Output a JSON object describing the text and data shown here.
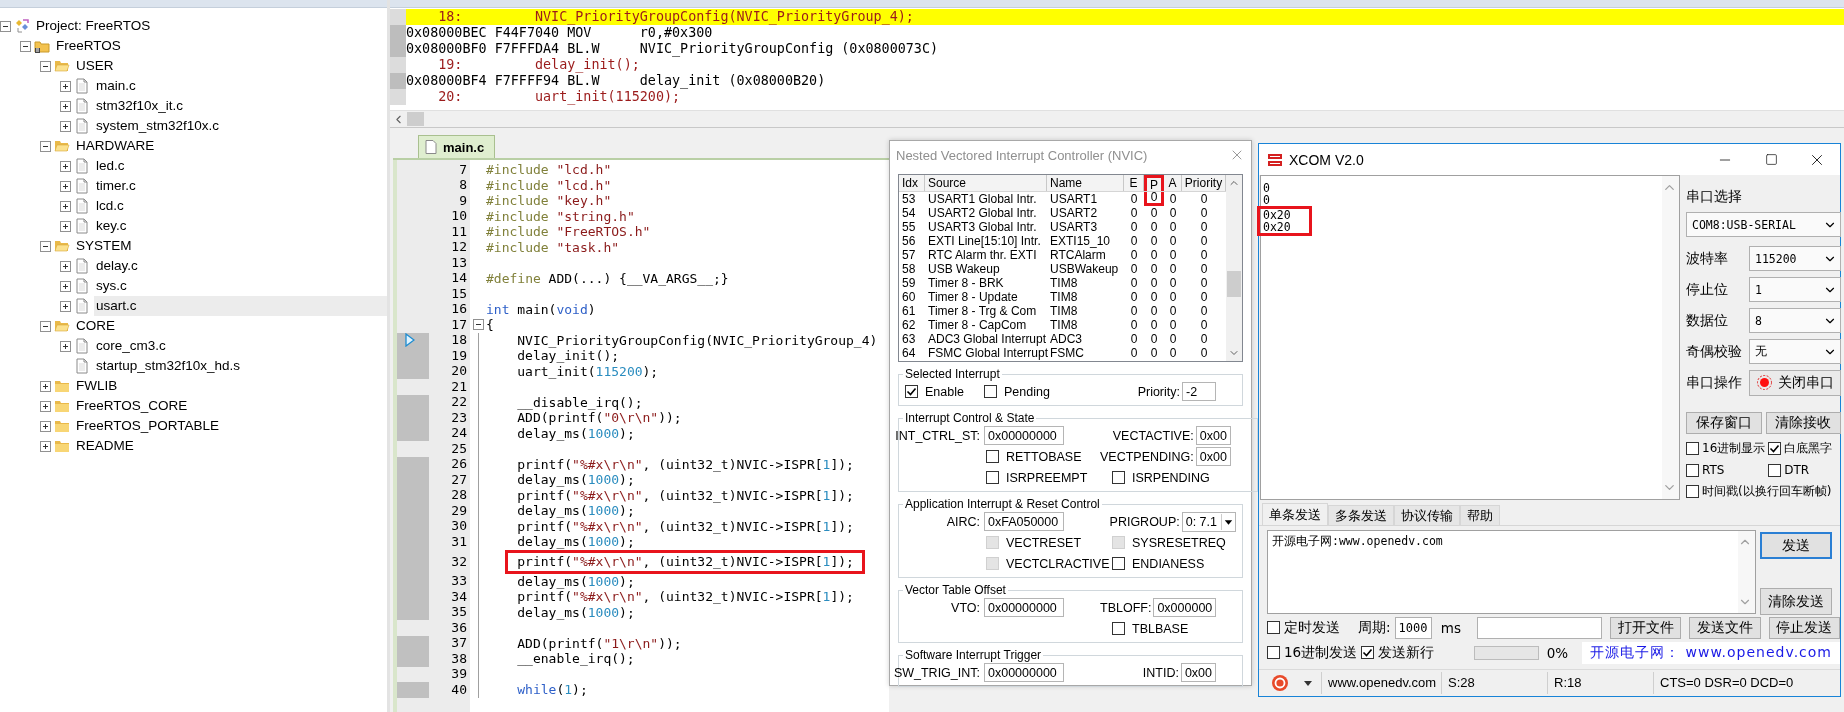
{
  "project": {
    "tree": [
      {
        "label": "Project: FreeRTOS",
        "kind": "project",
        "expanded": true,
        "selected": false,
        "children": [
          {
            "label": "FreeRTOS",
            "kind": "target",
            "expanded": true,
            "selected": false,
            "children": [
              {
                "label": "USER",
                "kind": "folder",
                "expanded": true,
                "selected": false,
                "children": [
                  {
                    "label": "main.c",
                    "kind": "file",
                    "expanded": false,
                    "selected": false
                  },
                  {
                    "label": "stm32f10x_it.c",
                    "kind": "file",
                    "expanded": false,
                    "selected": false
                  },
                  {
                    "label": "system_stm32f10x.c",
                    "kind": "file",
                    "expanded": false,
                    "selected": false
                  }
                ]
              },
              {
                "label": "HARDWARE",
                "kind": "folder",
                "expanded": true,
                "selected": false,
                "children": [
                  {
                    "label": "led.c",
                    "kind": "file",
                    "expanded": false,
                    "selected": false
                  },
                  {
                    "label": "timer.c",
                    "kind": "file",
                    "expanded": false,
                    "selected": false
                  },
                  {
                    "label": "lcd.c",
                    "kind": "file",
                    "expanded": false,
                    "selected": false
                  },
                  {
                    "label": "key.c",
                    "kind": "file",
                    "expanded": false,
                    "selected": false
                  }
                ]
              },
              {
                "label": "SYSTEM",
                "kind": "folder",
                "expanded": true,
                "selected": false,
                "children": [
                  {
                    "label": "delay.c",
                    "kind": "file",
                    "expanded": false,
                    "selected": false
                  },
                  {
                    "label": "sys.c",
                    "kind": "file",
                    "expanded": false,
                    "selected": false
                  },
                  {
                    "label": "usart.c",
                    "kind": "file",
                    "expanded": false,
                    "selected": true
                  }
                ]
              },
              {
                "label": "CORE",
                "kind": "folder",
                "expanded": true,
                "selected": false,
                "children": [
                  {
                    "label": "core_cm3.c",
                    "kind": "file",
                    "expanded": false,
                    "selected": false
                  },
                  {
                    "label": "startup_stm32f10x_hd.s",
                    "kind": "file",
                    "selected": false
                  }
                ]
              },
              {
                "label": "FWLIB",
                "kind": "folder",
                "expanded": false,
                "selected": false
              },
              {
                "label": "FreeRTOS_CORE",
                "kind": "folder",
                "expanded": false,
                "selected": false
              },
              {
                "label": "FreeRTOS_PORTABLE",
                "kind": "folder",
                "expanded": false,
                "selected": false
              },
              {
                "label": "README",
                "kind": "folder",
                "expanded": false,
                "selected": false
              }
            ]
          }
        ]
      }
    ]
  },
  "disassembly": {
    "lines": [
      {
        "kind": "source",
        "number": "18:",
        "text": "NVIC_PriorityGroupConfig(NVIC_PriorityGroup_4);",
        "current": true
      },
      {
        "kind": "asm",
        "address": "0x08000BEC",
        "opcode": "F44F7040",
        "mnemonic": "MOV",
        "operands": "r0,#0x300",
        "current": false
      },
      {
        "kind": "asm",
        "address": "0x08000BF0",
        "opcode": "F7FFFDA4",
        "mnemonic": "BL.W",
        "operands": "NVIC_PriorityGroupConfig (0x0800073C)",
        "current": false
      },
      {
        "kind": "source",
        "number": "19:",
        "text": "delay_init();",
        "current": false
      },
      {
        "kind": "asm",
        "address": "0x08000BF4",
        "opcode": "F7FFFF94",
        "mnemonic": "BL.W",
        "operands": "delay_init (0x08000B20)",
        "current": false
      },
      {
        "kind": "source",
        "number": "20:",
        "text": "uart_init(115200);",
        "current": false
      }
    ]
  },
  "editor": {
    "tabs": [
      {
        "label": "main.c",
        "selected": true
      }
    ],
    "lines": [
      {
        "number": "7",
        "indent": false,
        "executable": false,
        "current": false,
        "fold": false,
        "marked": false,
        "tokens": [
          {
            "kind": "pp",
            "text": "#include"
          },
          {
            "kind": "str",
            "text": " \"lcd.h\""
          }
        ]
      },
      {
        "number": "8",
        "indent": false,
        "executable": false,
        "current": false,
        "fold": false,
        "marked": false,
        "tokens": [
          {
            "kind": "pp",
            "text": "#include"
          },
          {
            "kind": "str",
            "text": " \"lcd.h\""
          }
        ]
      },
      {
        "number": "9",
        "indent": false,
        "executable": false,
        "current": false,
        "fold": false,
        "marked": false,
        "tokens": [
          {
            "kind": "pp",
            "text": "#include"
          },
          {
            "kind": "str",
            "text": " \"key.h\""
          }
        ]
      },
      {
        "number": "10",
        "indent": false,
        "executable": false,
        "current": false,
        "fold": false,
        "marked": false,
        "tokens": [
          {
            "kind": "pp",
            "text": "#include"
          },
          {
            "kind": "str",
            "text": " \"string.h\""
          }
        ]
      },
      {
        "number": "11",
        "indent": false,
        "executable": false,
        "current": false,
        "fold": false,
        "marked": false,
        "tokens": [
          {
            "kind": "pp",
            "text": "#include"
          },
          {
            "kind": "str",
            "text": " \"FreeRTOS.h\""
          }
        ]
      },
      {
        "number": "12",
        "indent": false,
        "executable": false,
        "current": false,
        "fold": false,
        "marked": false,
        "tokens": [
          {
            "kind": "pp",
            "text": "#include"
          },
          {
            "kind": "str",
            "text": " \"task.h\""
          }
        ]
      },
      {
        "number": "13",
        "executable": false,
        "current": false,
        "fold": false,
        "marked": false
      },
      {
        "number": "14",
        "indent": false,
        "executable": false,
        "current": false,
        "fold": false,
        "marked": false,
        "tokens": [
          {
            "kind": "pp",
            "text": "#define"
          },
          {
            "kind": "plain",
            "text": " ADD(...) {__VA_ARGS__;}"
          }
        ]
      },
      {
        "number": "15",
        "executable": false,
        "current": false,
        "fold": false,
        "marked": false
      },
      {
        "number": "16",
        "indent": false,
        "executable": false,
        "current": false,
        "fold": false,
        "marked": false,
        "tokens": [
          {
            "kind": "kw",
            "text": "int"
          },
          {
            "kind": "plain",
            "text": " main("
          },
          {
            "kind": "kw",
            "text": "void"
          },
          {
            "kind": "plain",
            "text": ")"
          }
        ]
      },
      {
        "number": "17",
        "indent": false,
        "executable": false,
        "current": false,
        "fold": true,
        "marked": false,
        "tokens": [
          {
            "kind": "plain",
            "text": "{"
          }
        ]
      },
      {
        "number": "18",
        "indent": true,
        "executable": true,
        "current": true,
        "fold": false,
        "marked": false,
        "tokens": [
          {
            "kind": "plain",
            "text": "NVIC_PriorityGroupConfig(NVIC_PriorityGroup_4)"
          }
        ]
      },
      {
        "number": "19",
        "indent": true,
        "executable": true,
        "current": false,
        "fold": false,
        "marked": false,
        "tokens": [
          {
            "kind": "plain",
            "text": "delay_init();"
          }
        ]
      },
      {
        "number": "20",
        "indent": true,
        "executable": true,
        "current": false,
        "fold": false,
        "marked": false,
        "tokens": [
          {
            "kind": "plain",
            "text": "uart_init("
          },
          {
            "kind": "num",
            "text": "115200"
          },
          {
            "kind": "plain",
            "text": ");"
          }
        ]
      },
      {
        "number": "21",
        "executable": false,
        "current": false,
        "fold": false,
        "marked": false
      },
      {
        "number": "22",
        "indent": true,
        "executable": true,
        "current": false,
        "fold": false,
        "marked": false,
        "tokens": [
          {
            "kind": "plain",
            "text": "__disable_irq();"
          }
        ]
      },
      {
        "number": "23",
        "indent": true,
        "executable": true,
        "current": false,
        "fold": false,
        "marked": false,
        "tokens": [
          {
            "kind": "plain",
            "text": "ADD(printf("
          },
          {
            "kind": "str",
            "text": "\"0\\r\\n\""
          },
          {
            "kind": "plain",
            "text": "));"
          }
        ]
      },
      {
        "number": "24",
        "indent": true,
        "executable": true,
        "current": false,
        "fold": false,
        "marked": false,
        "tokens": [
          {
            "kind": "plain",
            "text": "delay_ms("
          },
          {
            "kind": "num",
            "text": "1000"
          },
          {
            "kind": "plain",
            "text": ");"
          }
        ]
      },
      {
        "number": "25",
        "executable": false,
        "current": false,
        "fold": false,
        "marked": false
      },
      {
        "number": "26",
        "indent": true,
        "executable": true,
        "current": false,
        "fold": false,
        "marked": false,
        "tokens": [
          {
            "kind": "plain",
            "text": "printf("
          },
          {
            "kind": "str",
            "text": "\"%#x\\r\\n\""
          },
          {
            "kind": "plain",
            "text": ", (uint32_t)NVIC->ISPR["
          },
          {
            "kind": "num",
            "text": "1"
          },
          {
            "kind": "plain",
            "text": "]);"
          }
        ]
      },
      {
        "number": "27",
        "indent": true,
        "executable": true,
        "current": false,
        "fold": false,
        "marked": false,
        "tokens": [
          {
            "kind": "plain",
            "text": "delay_ms("
          },
          {
            "kind": "num",
            "text": "1000"
          },
          {
            "kind": "plain",
            "text": ");"
          }
        ]
      },
      {
        "number": "28",
        "indent": true,
        "executable": true,
        "current": false,
        "fold": false,
        "marked": false,
        "tokens": [
          {
            "kind": "plain",
            "text": "printf("
          },
          {
            "kind": "str",
            "text": "\"%#x\\r\\n\""
          },
          {
            "kind": "plain",
            "text": ", (uint32_t)NVIC->ISPR["
          },
          {
            "kind": "num",
            "text": "1"
          },
          {
            "kind": "plain",
            "text": "]);"
          }
        ]
      },
      {
        "number": "29",
        "indent": true,
        "executable": true,
        "current": false,
        "fold": false,
        "marked": false,
        "tokens": [
          {
            "kind": "plain",
            "text": "delay_ms("
          },
          {
            "kind": "num",
            "text": "1000"
          },
          {
            "kind": "plain",
            "text": ");"
          }
        ]
      },
      {
        "number": "30",
        "indent": true,
        "executable": true,
        "current": false,
        "fold": false,
        "marked": false,
        "tokens": [
          {
            "kind": "plain",
            "text": "printf("
          },
          {
            "kind": "str",
            "text": "\"%#x\\r\\n\""
          },
          {
            "kind": "plain",
            "text": ", (uint32_t)NVIC->ISPR["
          },
          {
            "kind": "num",
            "text": "1"
          },
          {
            "kind": "plain",
            "text": "]);"
          }
        ]
      },
      {
        "number": "31",
        "indent": true,
        "executable": true,
        "current": false,
        "fold": false,
        "marked": false,
        "tokens": [
          {
            "kind": "plain",
            "text": "delay_ms("
          },
          {
            "kind": "num",
            "text": "1000"
          },
          {
            "kind": "plain",
            "text": ");"
          }
        ]
      },
      {
        "number": "32",
        "indent": true,
        "executable": true,
        "current": false,
        "fold": false,
        "marked": true,
        "tokens": [
          {
            "kind": "plain",
            "text": "printf("
          },
          {
            "kind": "str",
            "text": "\"%#x\\r\\n\""
          },
          {
            "kind": "plain",
            "text": ", (uint32_t)NVIC->ISPR["
          },
          {
            "kind": "num",
            "text": "1"
          },
          {
            "kind": "plain",
            "text": "]);"
          }
        ]
      },
      {
        "number": "33",
        "indent": true,
        "executable": true,
        "current": false,
        "fold": false,
        "marked": false,
        "tokens": [
          {
            "kind": "plain",
            "text": "delay_ms("
          },
          {
            "kind": "num",
            "text": "1000"
          },
          {
            "kind": "plain",
            "text": ");"
          }
        ]
      },
      {
        "number": "34",
        "indent": true,
        "executable": true,
        "current": false,
        "fold": false,
        "marked": false,
        "tokens": [
          {
            "kind": "plain",
            "text": "printf("
          },
          {
            "kind": "str",
            "text": "\"%#x\\r\\n\""
          },
          {
            "kind": "plain",
            "text": ", (uint32_t)NVIC->ISPR["
          },
          {
            "kind": "num",
            "text": "1"
          },
          {
            "kind": "plain",
            "text": "]);"
          }
        ]
      },
      {
        "number": "35",
        "indent": true,
        "executable": true,
        "current": false,
        "fold": false,
        "marked": false,
        "tokens": [
          {
            "kind": "plain",
            "text": "delay_ms("
          },
          {
            "kind": "num",
            "text": "1000"
          },
          {
            "kind": "plain",
            "text": ");"
          }
        ]
      },
      {
        "number": "36",
        "executable": false,
        "current": false,
        "fold": false,
        "marked": false
      },
      {
        "number": "37",
        "indent": true,
        "executable": true,
        "current": false,
        "fold": false,
        "marked": false,
        "tokens": [
          {
            "kind": "plain",
            "text": "ADD(printf("
          },
          {
            "kind": "str",
            "text": "\"1\\r\\n\""
          },
          {
            "kind": "plain",
            "text": "));"
          }
        ]
      },
      {
        "number": "38",
        "indent": true,
        "executable": true,
        "current": false,
        "fold": false,
        "marked": false,
        "tokens": [
          {
            "kind": "plain",
            "text": "__enable_irq();"
          }
        ]
      },
      {
        "number": "39",
        "executable": false,
        "current": false,
        "fold": false,
        "marked": false
      },
      {
        "number": "40",
        "indent": true,
        "executable": true,
        "current": false,
        "fold": false,
        "marked": false,
        "tokens": [
          {
            "kind": "kw",
            "text": "while"
          },
          {
            "kind": "plain",
            "text": "("
          },
          {
            "kind": "num",
            "text": "1"
          },
          {
            "kind": "plain",
            "text": ");"
          }
        ]
      }
    ]
  },
  "nvic": {
    "title": "Nested Vectored Interrupt Controller (NVIC)",
    "columns": [
      {
        "label": "Idx",
        "marked": false
      },
      {
        "label": "Source",
        "marked": false
      },
      {
        "label": "Name",
        "marked": false
      },
      {
        "label": "E",
        "marked": false
      },
      {
        "label": "P",
        "marked": true
      },
      {
        "label": "A",
        "marked": false
      },
      {
        "label": "Priority",
        "marked": false
      }
    ],
    "rows": [
      {
        "cells": [
          "53",
          "USART1 Global Intr.",
          "USART1",
          "0",
          "0",
          "0",
          "0"
        ]
      },
      {
        "cells": [
          "54",
          "USART2 Global Intr.",
          "USART2",
          "0",
          "0",
          "0",
          "0"
        ]
      },
      {
        "cells": [
          "55",
          "USART3 Global Intr.",
          "USART3",
          "0",
          "0",
          "0",
          "0"
        ]
      },
      {
        "cells": [
          "56",
          "EXTI Line[15:10] Intr.",
          "EXTI15_10",
          "0",
          "0",
          "0",
          "0"
        ]
      },
      {
        "cells": [
          "57",
          "RTC Alarm thr. EXTI",
          "RTCAlarm",
          "0",
          "0",
          "0",
          "0"
        ]
      },
      {
        "cells": [
          "58",
          "USB Wakeup",
          "USBWakeup",
          "0",
          "0",
          "0",
          "0"
        ]
      },
      {
        "cells": [
          "59",
          "Timer 8 - BRK",
          "TIM8",
          "0",
          "0",
          "0",
          "0"
        ]
      },
      {
        "cells": [
          "60",
          "Timer 8 - Update",
          "TIM8",
          "0",
          "0",
          "0",
          "0"
        ]
      },
      {
        "cells": [
          "61",
          "Timer 8 - Trg & Com",
          "TIM8",
          "0",
          "0",
          "0",
          "0"
        ]
      },
      {
        "cells": [
          "62",
          "Timer 8 - CapCom",
          "TIM8",
          "0",
          "0",
          "0",
          "0"
        ]
      },
      {
        "cells": [
          "63",
          "ADC3 Global Interrupt",
          "ADC3",
          "0",
          "0",
          "0",
          "0"
        ]
      },
      {
        "cells": [
          "64",
          "FSMC Global Interrupt",
          "FSMC",
          "0",
          "0",
          "0",
          "0"
        ]
      }
    ],
    "groups": [
      {
        "title": "Selected Interrupt",
        "rows": [
          {
            "left": [
              {
                "kind": "checkbox",
                "label": "Enable",
                "checked": true,
                "disabled": false
              },
              {
                "kind": "checkbox",
                "label": "Pending",
                "checked": false,
                "disabled": false
              }
            ],
            "right": [
              {
                "kind": "field",
                "label": "Priority:",
                "value": "-2"
              }
            ]
          }
        ]
      },
      {
        "title": "Interrupt Control & State",
        "rows": [
          {
            "left": [
              {
                "kind": "field",
                "label": "INT_CTRL_ST:",
                "value": "0x00000000"
              }
            ],
            "right": [
              {
                "kind": "field",
                "label": "VECTACTIVE:",
                "value": "0x00"
              }
            ]
          },
          {
            "left": [
              {
                "kind": "checkbox",
                "label": "RETTOBASE",
                "checked": false,
                "disabled": false
              }
            ],
            "right": [
              {
                "kind": "field",
                "label": "VECTPENDING:",
                "value": "0x00"
              }
            ]
          },
          {
            "left": [
              {
                "kind": "checkbox",
                "label": "ISRPREEMPT",
                "checked": false,
                "disabled": false
              }
            ],
            "right": [
              {
                "kind": "checkbox",
                "label": "ISRPENDING",
                "checked": false,
                "disabled": false
              }
            ]
          }
        ]
      },
      {
        "title": "Application Interrupt & Reset Control",
        "rows": [
          {
            "left": [
              {
                "kind": "field",
                "label": "AIRC:",
                "value": "0xFA050000"
              }
            ],
            "right": [
              {
                "kind": "select",
                "label": "PRIGROUP:",
                "value": "0: 7.1"
              }
            ]
          },
          {
            "left": [
              {
                "kind": "checkbox",
                "label": "VECTRESET",
                "checked": false,
                "disabled": true
              }
            ],
            "right": [
              {
                "kind": "checkbox",
                "label": "SYSRESETREQ",
                "checked": false,
                "disabled": true
              }
            ]
          },
          {
            "left": [
              {
                "kind": "checkbox",
                "label": "VECTCLRACTIVE",
                "checked": false,
                "disabled": true
              }
            ],
            "right": [
              {
                "kind": "checkbox",
                "label": "ENDIANESS",
                "checked": false,
                "disabled": false
              }
            ]
          }
        ]
      },
      {
        "title": "Vector Table Offset",
        "rows": [
          {
            "left": [
              {
                "kind": "field",
                "label": "VTO:",
                "value": "0x00000000"
              }
            ],
            "right": [
              {
                "kind": "field",
                "label": "TBLOFF:",
                "value": "0x000000"
              }
            ]
          },
          {
            "left": [],
            "right": [
              {
                "kind": "checkbox",
                "label": "TBLBASE",
                "checked": false,
                "disabled": false
              }
            ]
          }
        ]
      },
      {
        "title": "Software Interrupt Trigger",
        "rows": [
          {
            "left": [
              {
                "kind": "field",
                "label": "SW_TRIG_INT:",
                "value": "0x00000000"
              }
            ],
            "right": [
              {
                "kind": "field",
                "label": "INTID:",
                "value": "0x00"
              }
            ]
          }
        ]
      }
    ]
  },
  "xcom": {
    "title": "XCOM V2.0",
    "output": [
      {
        "text": "0",
        "marked": false
      },
      {
        "text": "0",
        "marked": false
      },
      {
        "text": "0x20",
        "marked": true
      },
      {
        "text": "0x20",
        "marked": true
      }
    ],
    "port": {
      "label": "串口选择",
      "value": "COM8:USB-SERIAL"
    },
    "settings": [
      {
        "kind": "select",
        "label": "波特率",
        "value": "115200"
      },
      {
        "kind": "select",
        "label": "停止位",
        "value": "1"
      },
      {
        "kind": "select",
        "label": "数据位",
        "value": "8"
      },
      {
        "kind": "select",
        "label": "奇偶校验",
        "value": "无"
      },
      {
        "kind": "button",
        "label": "串口操作",
        "value": "关闭串口"
      }
    ],
    "actions": [
      "保存窗口",
      "清除接收"
    ],
    "options": [
      {
        "label": "16进制显示",
        "checked": false
      },
      {
        "label": "白底黑字",
        "checked": true
      },
      {
        "label": "RTS",
        "checked": false
      },
      {
        "label": "DTR",
        "checked": false
      },
      {
        "label": "时间戳(以换行回车断帧)",
        "checked": false
      }
    ],
    "tabs": [
      {
        "label": "单条发送",
        "selected": true
      },
      {
        "label": "多条发送",
        "selected": false
      },
      {
        "label": "协议传输",
        "selected": false
      },
      {
        "label": "帮助",
        "selected": false
      }
    ],
    "send_text": "开源电子网:www.openedv.com",
    "send_buttons": [
      {
        "label": "发送",
        "focused": true
      },
      {
        "label": "清除发送",
        "focused": false
      }
    ],
    "timed": {
      "label": "定时发送",
      "checked": false
    },
    "period": {
      "label": "周期:",
      "value": "1000",
      "unit": "ms"
    },
    "file_buttons": [
      "打开文件",
      "发送文件",
      "停止发送"
    ],
    "hex_send": {
      "label": "16进制发送",
      "checked": false
    },
    "newline": {
      "label": "发送新行",
      "checked": true
    },
    "progress": {
      "level": 0,
      "reading": "0%"
    },
    "link": "开源电子网： www.openedv.com",
    "status": [
      "www.openedv.com",
      "S:28",
      "R:18",
      "CTS=0 DSR=0 DCD=0"
    ]
  }
}
